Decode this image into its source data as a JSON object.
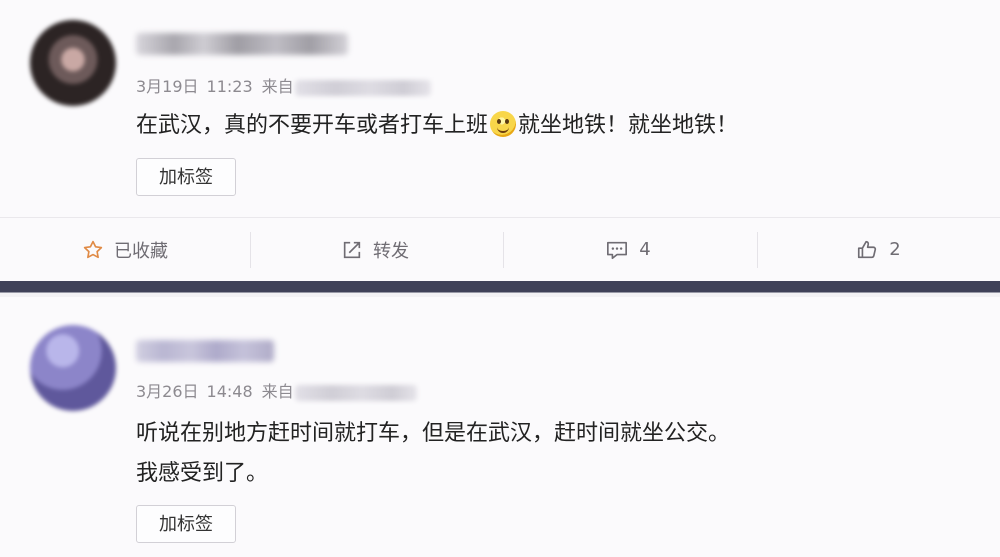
{
  "posts": [
    {
      "date": "3月19日",
      "time": "11:23",
      "source_label": "来自",
      "content": [
        "在武汉，真的不要开车或者打车上班",
        "就坐地铁！就坐地铁！"
      ],
      "emoji": "smile-emoji",
      "tag_button": "加标签"
    },
    {
      "date": "3月26日",
      "time": "14:48",
      "source_label": "来自",
      "content": [
        "听说在别地方赶时间就打车，但是在武汉，赶时间就坐公交。",
        "我感受到了。"
      ],
      "tag_button": "加标签"
    }
  ],
  "actions": {
    "favorite": {
      "label": "已收藏",
      "icon": "star-outline-icon",
      "icon_color": "#e08a45"
    },
    "repost": {
      "label": "转发",
      "icon": "share-icon"
    },
    "comment": {
      "count": "4",
      "icon": "comment-icon"
    },
    "like": {
      "count": "2",
      "icon": "thumbs-up-icon"
    }
  },
  "colors": {
    "background": "#fbfafc",
    "separator": "#3f4158",
    "meta_text": "#8d8a90",
    "action_text": "#6f6c73"
  }
}
